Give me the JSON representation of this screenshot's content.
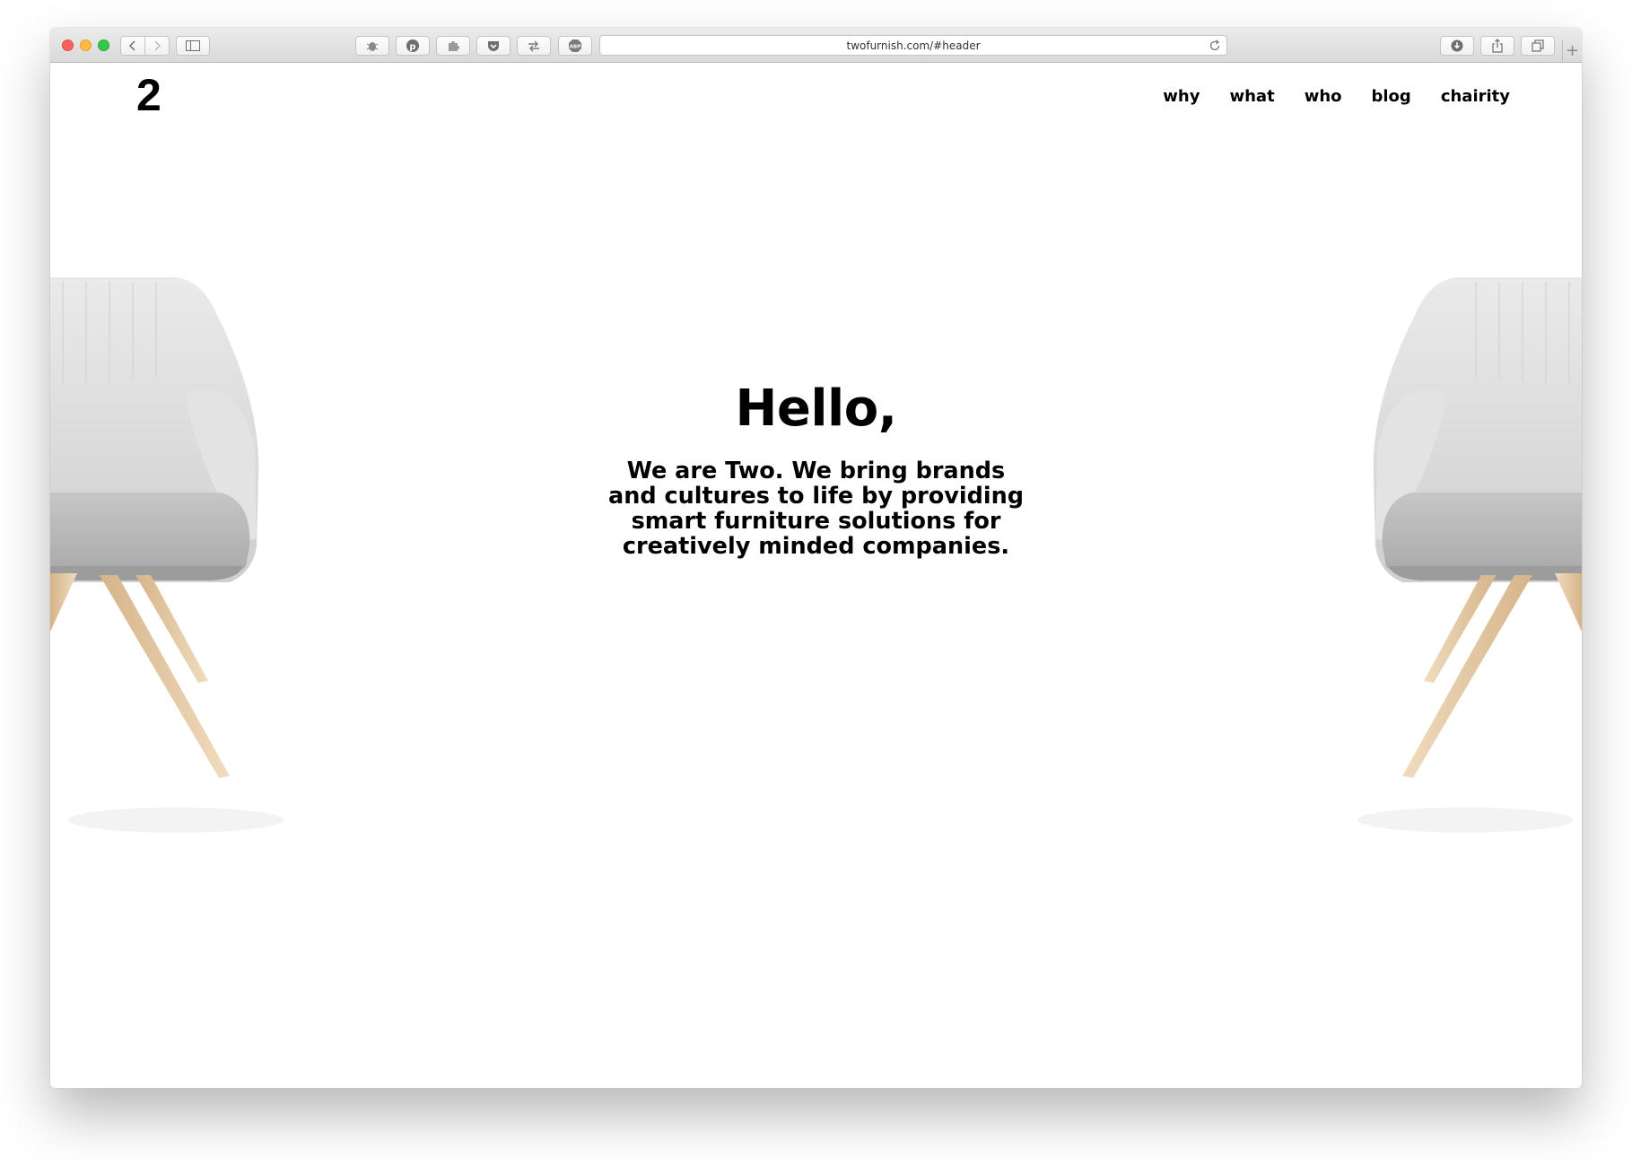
{
  "browser": {
    "url": "twofurnish.com/#header",
    "new_tab_label": "+"
  },
  "site": {
    "logo": "2",
    "nav": [
      "why",
      "what",
      "who",
      "blog",
      "chairity"
    ],
    "hero_title": "Hello,",
    "hero_text": "We are Two. We bring brands and cultures to life by providing smart furniture solutions for creatively minded companies."
  },
  "colors": {
    "close": "#fc605c",
    "minimize": "#fdbc40",
    "maximize": "#34c84a",
    "text": "#000000",
    "chair_fabric": "#c8c8c8",
    "chair_wood": "#e2c8a2"
  },
  "icons": {
    "back": "chevron-left-icon",
    "forward": "chevron-right-icon",
    "sidebar": "sidebar-icon",
    "extensions": [
      "bug-icon",
      "pinterest-icon",
      "puzzle-icon",
      "pocket-icon",
      "arrows-swap-icon",
      "adblock-icon"
    ],
    "reload": "reload-icon",
    "download": "download-icon",
    "share": "share-icon",
    "tabs": "tabs-overview-icon"
  }
}
